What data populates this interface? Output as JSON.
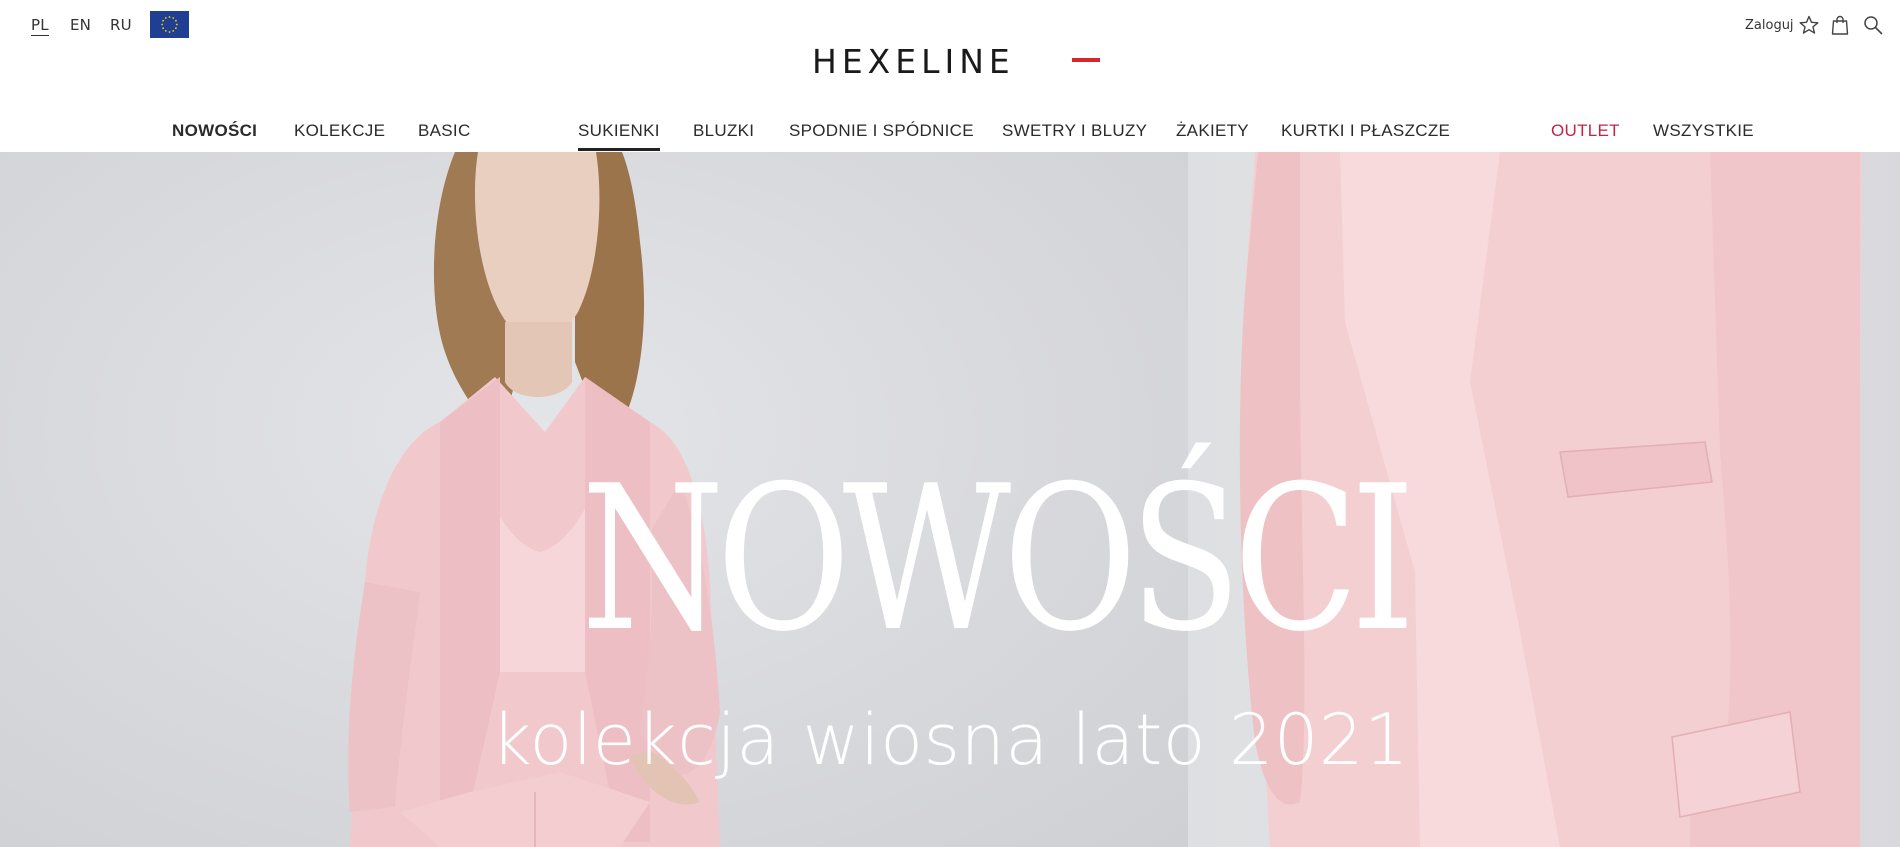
{
  "languages": [
    {
      "code": "PL",
      "active": true
    },
    {
      "code": "EN",
      "active": false
    },
    {
      "code": "RU",
      "active": false
    }
  ],
  "region_flag": {
    "icon": "eu-flag-icon",
    "color": "#1f3f93"
  },
  "brand": {
    "logo_text": "HEXELINE",
    "accent_color": "#d8262e"
  },
  "account": {
    "login_label": "Zaloguj",
    "icons": [
      "star-icon",
      "shopping-bag-icon",
      "search-icon"
    ]
  },
  "nav": {
    "items": [
      {
        "label": "NOWOŚCI",
        "bold": true
      },
      {
        "label": "KOLEKCJE"
      },
      {
        "label": "BASIC"
      },
      {
        "label": "SUKIENKI",
        "active": true
      },
      {
        "label": "BLUZKI"
      },
      {
        "label": "SPODNIE I SPÓDNICE"
      },
      {
        "label": "SWETRY I BLUZY"
      },
      {
        "label": "ŻAKIETY"
      },
      {
        "label": "KURTKI I PŁASZCZE"
      },
      {
        "label": "OUTLET",
        "color": "#c02447"
      },
      {
        "label": "WSZYSTKIE"
      }
    ]
  },
  "hero": {
    "title": "NOWOŚCI",
    "subtitle": "kolekcja wiosna lato 2021",
    "garment_color": "#f2c9cc",
    "background_color": "#d5d6da"
  }
}
